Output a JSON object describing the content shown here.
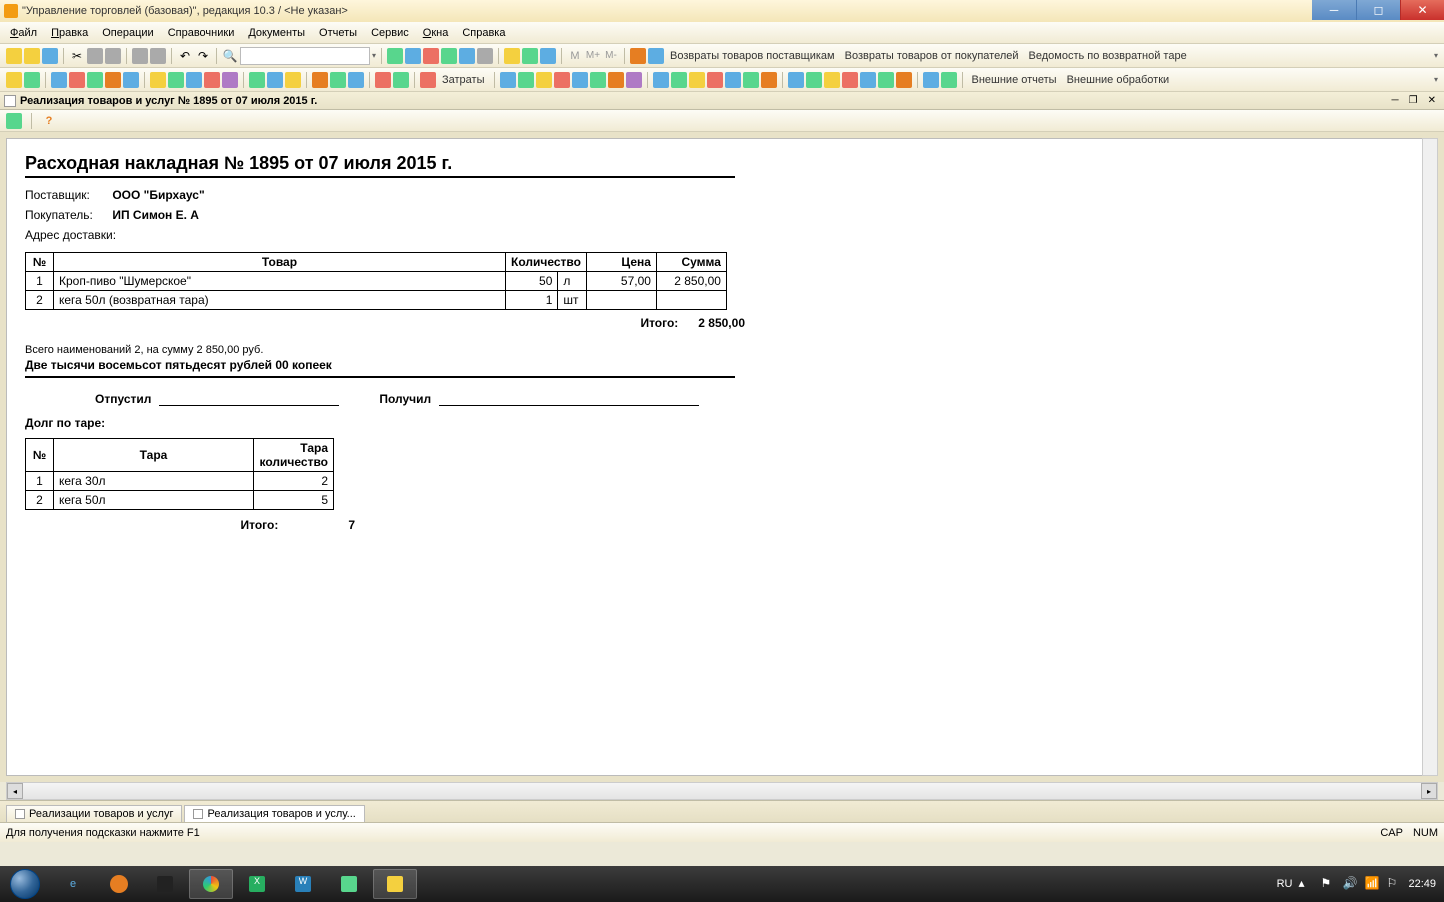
{
  "titlebar": {
    "text": "\"Управление торговлей (базовая)\", редакция 10.3 / <Не указан>"
  },
  "menubar": {
    "file": "Файл",
    "edit": "Правка",
    "operations": "Операции",
    "refs": "Справочники",
    "docs": "Документы",
    "reports": "Отчеты",
    "service": "Сервис",
    "windows": "Окна",
    "help": "Справка"
  },
  "toolbar1": {
    "returns_suppliers": "Возвраты товаров поставщикам",
    "returns_buyers": "Возвраты товаров от покупателей",
    "vedomost": "Ведомость по возвратной таре"
  },
  "toolbar2": {
    "zatraty": "Затраты",
    "ext_reports": "Внешние отчеты",
    "ext_processing": "Внешние обработки"
  },
  "doctab": {
    "title": "Реализация товаров и услуг № 1895 от 07 июля 2015 г."
  },
  "document": {
    "title": "Расходная накладная № 1895 от 07 июля 2015 г.",
    "supplier_label": "Поставщик:",
    "supplier_value": "ООО \"Бирхаус\"",
    "buyer_label": "Покупатель:",
    "buyer_value": "ИП Симон Е. А",
    "address_label": "Адрес доставки:",
    "address_value": "",
    "goods_headers": {
      "num": "№",
      "name": "Товар",
      "qty": "Количество",
      "price": "Цена",
      "sum": "Сумма"
    },
    "goods": [
      {
        "n": "1",
        "name": "Кроп-пиво \"Шумерское\"",
        "qty": "50",
        "unit": "л",
        "price": "57,00",
        "sum": "2 850,00"
      },
      {
        "n": "2",
        "name": "кега 50л (возвратная тара)",
        "qty": "1",
        "unit": "шт",
        "price": "",
        "sum": ""
      }
    ],
    "total_label": "Итого:",
    "total_value": "2 850,00",
    "summary_line": "Всего наименований 2, на сумму 2 850,00 руб.",
    "summary_words": "Две тысячи восемьсот пятьдесят рублей 00 копеек",
    "released_label": "Отпустил",
    "received_label": "Получил",
    "debt_label": "Долг по таре:",
    "tare_headers": {
      "num": "№",
      "name": "Тара",
      "qty": "Тара количество"
    },
    "tare": [
      {
        "n": "1",
        "name": "кега 30л",
        "qty": "2"
      },
      {
        "n": "2",
        "name": "кега 50л",
        "qty": "5"
      }
    ],
    "tare_total_label": "Итого:",
    "tare_total_value": "7"
  },
  "bottom_tabs": {
    "tab1": "Реализации товаров и услуг",
    "tab2": "Реализация товаров и услу..."
  },
  "statusbar": {
    "hint": "Для получения подсказки нажмите F1",
    "cap": "CAP",
    "num": "NUM"
  },
  "tray": {
    "lang": "RU",
    "time": "22:49"
  }
}
